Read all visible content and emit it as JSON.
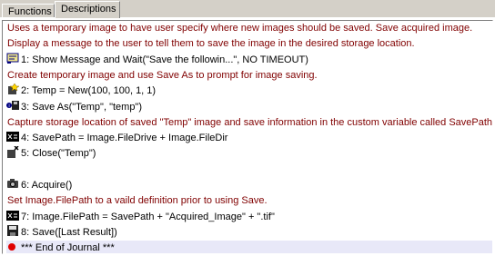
{
  "tabs": [
    {
      "label": "Functions",
      "active": false
    },
    {
      "label": "Descriptions",
      "active": true
    }
  ],
  "rows": [
    {
      "kind": "comment",
      "text": "Uses a temporary image to have user specify where new images should be saved. Save acquired image."
    },
    {
      "kind": "comment",
      "text": "Display a message to the user to tell them to save the image in the desired storage location."
    },
    {
      "kind": "step",
      "icon": "message-icon",
      "text": "1: Show Message and Wait(\"Save the followin...\", NO TIMEOUT)"
    },
    {
      "kind": "comment",
      "text": "Create temporary image and use Save As to prompt for image saving."
    },
    {
      "kind": "step",
      "icon": "new-image-icon",
      "text": "2: Temp = New(100, 100, 1, 1)"
    },
    {
      "kind": "step",
      "icon": "save-as-icon",
      "text": "3: Save As(\"Temp\", \"temp\")"
    },
    {
      "kind": "comment",
      "text": "Capture storage location of saved \"Temp\" image and save information in the custom variable called SavePath."
    },
    {
      "kind": "step",
      "icon": "variable-icon",
      "text": "4: SavePath = Image.FileDrive + Image.FileDir"
    },
    {
      "kind": "step",
      "icon": "close-image-icon",
      "text": "5: Close(\"Temp\")"
    },
    {
      "kind": "blank",
      "text": ""
    },
    {
      "kind": "step",
      "icon": "camera-icon",
      "text": "6: Acquire()"
    },
    {
      "kind": "comment",
      "text": "Set Image.FilePath to a vaild definition prior to using Save."
    },
    {
      "kind": "step",
      "icon": "variable-icon",
      "text": "7: Image.FilePath = SavePath + \"Acquired_Image\" + \".tif\""
    },
    {
      "kind": "step",
      "icon": "save-icon",
      "text": "8: Save([Last Result])"
    },
    {
      "kind": "end",
      "icon": "end-dot-icon",
      "text": "*** End of Journal ***"
    }
  ]
}
